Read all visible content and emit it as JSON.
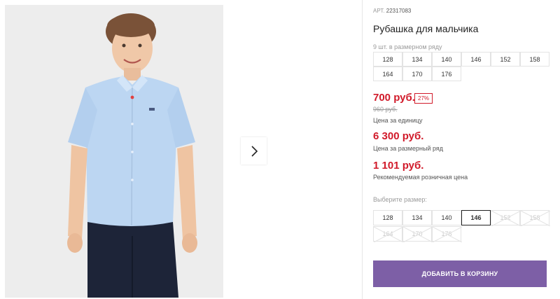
{
  "product": {
    "article_label": "АРТ.",
    "article_number": "22317083",
    "title": "Рубашка для мальчика",
    "pack_note": "9 шт. в размерном ряду",
    "pack_sizes": [
      "128",
      "134",
      "140",
      "146",
      "152",
      "158",
      "164",
      "170",
      "176"
    ]
  },
  "pricing": {
    "price": "700 руб.",
    "discount": "27%",
    "old_price": "960 руб.",
    "price_caption": "Цена за единицу",
    "row_price": "6 300 руб.",
    "row_caption": "Цена за размерный ряд",
    "retail_price": "1 101 руб.",
    "retail_caption": "Рекомендуемая розничная цена",
    "accent_color": "#d11a2a"
  },
  "size_select": {
    "label": "Выберите размер:",
    "options": [
      {
        "label": "128",
        "state": "available"
      },
      {
        "label": "134",
        "state": "available"
      },
      {
        "label": "140",
        "state": "available"
      },
      {
        "label": "146",
        "state": "selected"
      },
      {
        "label": "152",
        "state": "unavailable"
      },
      {
        "label": "158",
        "state": "unavailable"
      },
      {
        "label": "164",
        "state": "unavailable"
      },
      {
        "label": "170",
        "state": "unavailable"
      },
      {
        "label": "176",
        "state": "unavailable"
      }
    ]
  },
  "cart": {
    "button_label": "ДОБАВИТЬ В КОРЗИНУ",
    "button_color": "#7d5fa6"
  },
  "gallery": {
    "next_icon": "chevron-right-icon"
  }
}
